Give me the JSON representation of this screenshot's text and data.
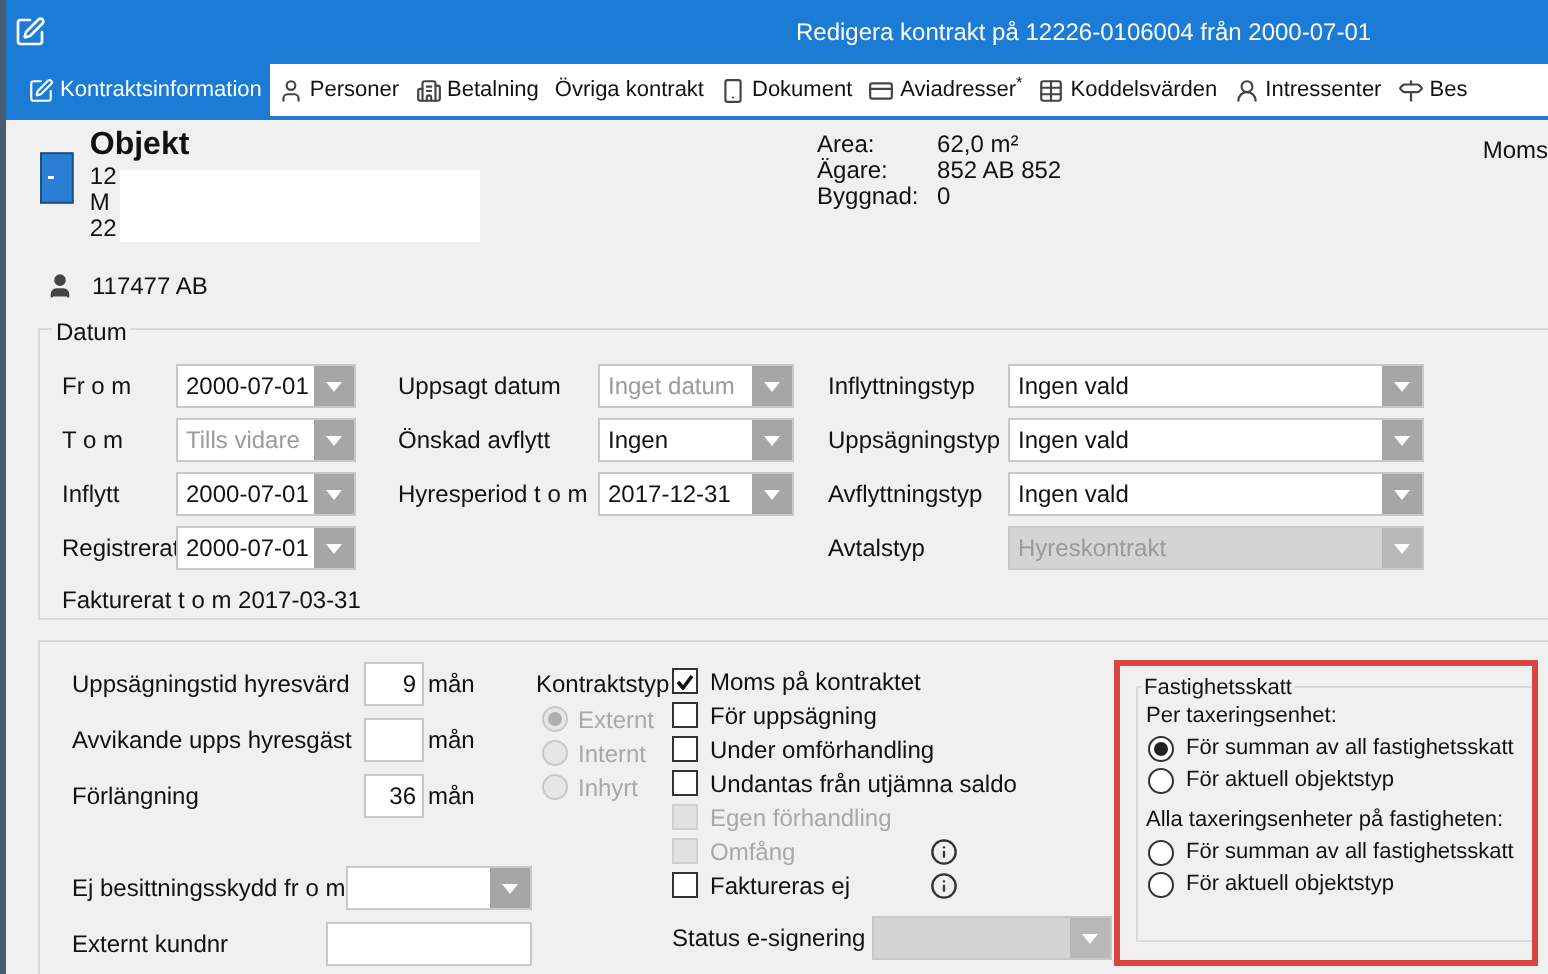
{
  "window": {
    "title": "Redigera kontrakt på 12226-0106004 från 2000-07-01"
  },
  "tabs": [
    {
      "label": "Kontraktsinformation",
      "selected": true
    },
    {
      "label": "Personer",
      "selected": false
    },
    {
      "label": "Betalning",
      "selected": false
    },
    {
      "label": "Övriga kontrakt",
      "selected": false
    },
    {
      "label": "Dokument",
      "selected": false
    },
    {
      "label": "Aviadresser$^{*}$",
      "selected": false
    },
    {
      "label": "Koddelsvärden",
      "selected": false
    },
    {
      "label": "Intressenter",
      "selected": false
    },
    {
      "label": "Bes",
      "selected": false
    }
  ],
  "object": {
    "heading": "Objekt",
    "lines": [
      "12",
      "M",
      "22"
    ],
    "facts": [
      {
        "label": "Area:",
        "value": "62,0 m²"
      },
      {
        "label": "Ägare:",
        "value": "852 AB 852"
      },
      {
        "label": "Byggnad:",
        "value": "0"
      }
    ],
    "column_3": "Moms"
  },
  "person": {
    "name": "117477 AB"
  },
  "datum": {
    "title": "Datum",
    "column_1": [
      {
        "label": "Fr o m",
        "value": "2000-07-01"
      },
      {
        "label": "T o m",
        "placeholder": "Tills vidare"
      },
      {
        "label": "Inflytt",
        "value": "2000-07-01"
      },
      {
        "label": "Registrerat",
        "value": "2000-07-01"
      }
    ],
    "column_2": [
      {
        "label": "Uppsagt datum",
        "placeholder": "Inget datum"
      },
      {
        "label": "Önskad avflytt",
        "value": "Ingen"
      },
      {
        "label": "Hyresperiod t o m",
        "value": "2017-12-31"
      }
    ],
    "column_3": [
      {
        "label": "Inflyttningstyp",
        "value": "Ingen vald",
        "disabled": false
      },
      {
        "label": "Uppsägningstyp",
        "value": "Ingen vald",
        "disabled": false
      },
      {
        "label": "Avflyttningstyp",
        "value": "Ingen vald",
        "disabled": false
      },
      {
        "label": "Avtalstyp",
        "value": "Hyreskontrakt",
        "disabled": true
      }
    ],
    "invoiced": "Fakturerat t o m 2017-03-31"
  },
  "terms": [
    {
      "label": "Uppsägningstid hyresvärd",
      "value": "9",
      "unit": "mån"
    },
    {
      "label": "Avvikande upps hyresgäst",
      "unit": "mån"
    },
    {
      "label": "Förlängning",
      "value": "36",
      "unit": "mån"
    }
  ],
  "no_tenure_protection": {
    "label": "Ej besittningsskydd fr o m"
  },
  "external_customer": {
    "label": "Externt kundnr"
  },
  "contract_type": {
    "label": "Kontraktstyp",
    "options": [
      {
        "label": "Externt",
        "selected": true
      },
      {
        "label": "Internt",
        "selected": false
      },
      {
        "label": "Inhyrt",
        "selected": false
      }
    ]
  },
  "flags": [
    {
      "label": "Moms på kontraktet",
      "checked": true,
      "disabled": false,
      "info": false
    },
    {
      "label": "För uppsägning",
      "checked": false,
      "disabled": false,
      "info": false
    },
    {
      "label": "Under omförhandling",
      "checked": false,
      "disabled": false,
      "info": false
    },
    {
      "label": "Undantas från utjämna saldo",
      "checked": false,
      "disabled": false,
      "info": false
    },
    {
      "label": "Egen förhandling",
      "checked": false,
      "disabled": true,
      "info": false
    },
    {
      "label": "Omfång",
      "checked": false,
      "disabled": true,
      "info": true
    },
    {
      "label": "Faktureras ej",
      "checked": false,
      "disabled": false,
      "info": true
    }
  ],
  "e_signing": {
    "label": "Status e-signering"
  },
  "property_tax": {
    "title": "Fastighetsskatt",
    "groups": [
      {
        "heading": "Per taxeringsenhet:",
        "options": [
          {
            "label": "För summan av all fastighetsskatt",
            "selected": true
          },
          {
            "label": "För aktuell objektstyp",
            "selected": false
          }
        ]
      },
      {
        "heading": "Alla taxeringsenheter på fastigheten:",
        "options": [
          {
            "label": "För summan av all fastighetsskatt",
            "selected": false
          },
          {
            "label": "För aktuell objektstyp",
            "selected": false
          }
        ]
      }
    ]
  }
}
